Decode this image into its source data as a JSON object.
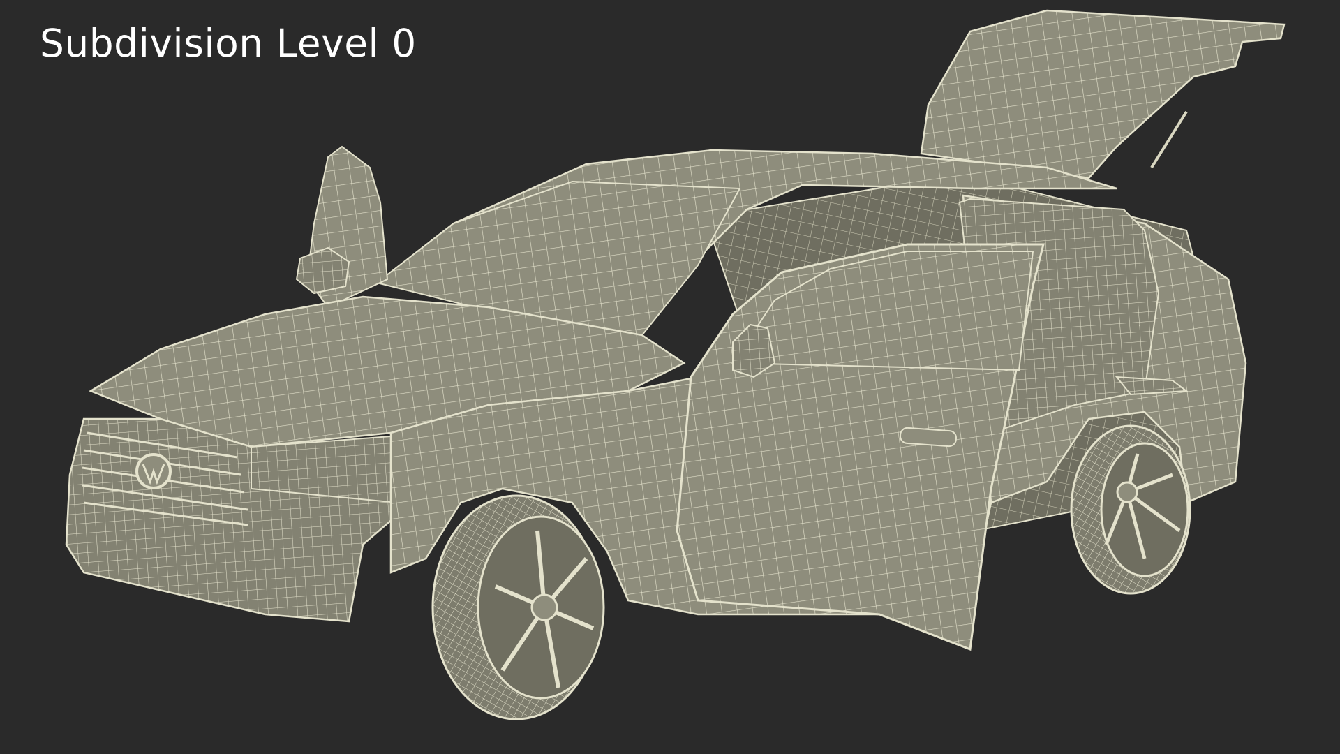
{
  "caption": "Subdivision Level 0",
  "colors": {
    "background": "#2a2a2a",
    "surface": "#8e8d7c",
    "surface_dark": "#6f6e60",
    "wire": "#e4e2cc",
    "caption": "#ffffff"
  }
}
